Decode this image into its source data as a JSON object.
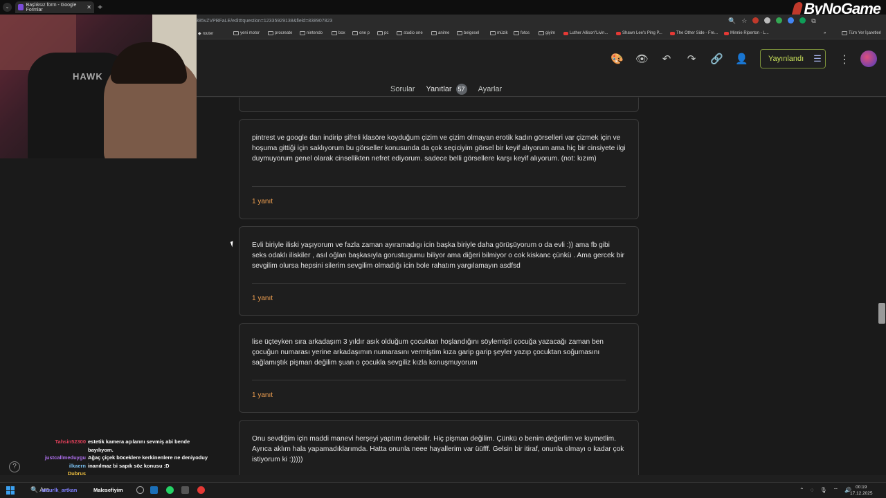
{
  "browser": {
    "tab_title": "Başlıksız form - Google Formlar",
    "url_fragment": "385vZVPBFaLE/edit#question=12335929138&field=838907823",
    "brand": "ByNoGame",
    "bookmarks": [
      "router",
      "yeni motor",
      "procreate",
      "nintendo",
      "box",
      "one p",
      "pc",
      "studio one",
      "anime",
      "belgesel",
      "müzik",
      "fotos",
      "giyim",
      "Luther Allison\"Livin...",
      "Shawn Lee's Ping P...",
      "The Other Side - Fre...",
      "Minnie Riperton - L...",
      "Tüm Yer İşaretleri"
    ]
  },
  "forms": {
    "publish_label": "Yayınlandı",
    "tabs": [
      {
        "label": "Sorular"
      },
      {
        "label": "Yanıtlar",
        "count": "57"
      },
      {
        "label": "Ayarlar"
      }
    ],
    "responses": [
      {
        "text": "pintrest ve google dan indirip şifreli klasöre koyduğum çizim ve çizim olmayan erotik kadın görselleri var çizmek için ve hoşuma gittiği için saklıyorum bu görseller konusunda da çok seçiciyim görsel bir keyif alıyorum ama hiç bir cinsiyete ilgi duymuyorum genel olarak cinsellikten nefret ediyorum. sadece belli görsellere karşı keyif alıyorum. (not: kızım)",
        "reply": "1 yanıt"
      },
      {
        "text": "Evli biriyle iliski yaşıyorum ve fazla zaman ayıramadıgı icin başka biriyle daha görüşüyorum o da evli :)) ama fb gibi seks odaklı iliskiler , asıl oğlan başkasıyla gorustugumu biliyor ama diğeri bilmiyor o cok kiskanc çünkü . Ama gercek bir sevgilim olursa hepsini silerim sevgilim olmadığı icin bole rahatım yargılamayın asdfsd",
        "reply": "1 yanıt"
      },
      {
        "text": "lise üçteyken sıra arkadaşım 3 yıldır asık olduğum çocuktan hoşlandığını söylemişti çocuğa yazacağı zaman ben çocuğun numarası yerine arkadaşımın numarasını vermiştim kıza garip garip şeyler yazıp çocuktan soğumasını sağlamıştık pişman değilim şuan o çocukla sevgiliz kızla konuşmuyorum",
        "reply": "1 yanıt"
      },
      {
        "text": "Onu sevdiğim için maddi manevi herşeyi yaptım denebilir. Hiç pişman değilim. Çünkü o benim değerlim ve kıymetlim. Ayrıca aklım hala yapamadıklarımda. Hatta onunla neee hayallerim var üüfff. Gelsin bir itiraf, onunla olmayı o kadar çok istiyorum ki :)))))",
        "reply": ""
      }
    ]
  },
  "stream": {
    "webcam_logo": "HAWK",
    "chat": [
      {
        "user": "Tahsin52300",
        "color": "#e0405a",
        "msg": "estetik kamera açılarını sevmiş abi bende bayılıyom."
      },
      {
        "user": "justcallmeduygu",
        "color": "#b070f0",
        "msg": "Ağaç çiçek böceklere kerkinenlere ne deniyoduy"
      },
      {
        "user": "ilkaern",
        "color": "#7ac0f0",
        "msg": "inanılmaz bi sapık söz konusu :D"
      },
      {
        "user": "Dubrus",
        "color": "#f0c040",
        "msg": ""
      },
      {
        "user": "amurlk_artkan",
        "color": "#8080ff",
        "msg": "Malesefiyim"
      }
    ]
  },
  "taskbar": {
    "search": "Ara",
    "time": "00:19",
    "date": "17.12.2025"
  }
}
